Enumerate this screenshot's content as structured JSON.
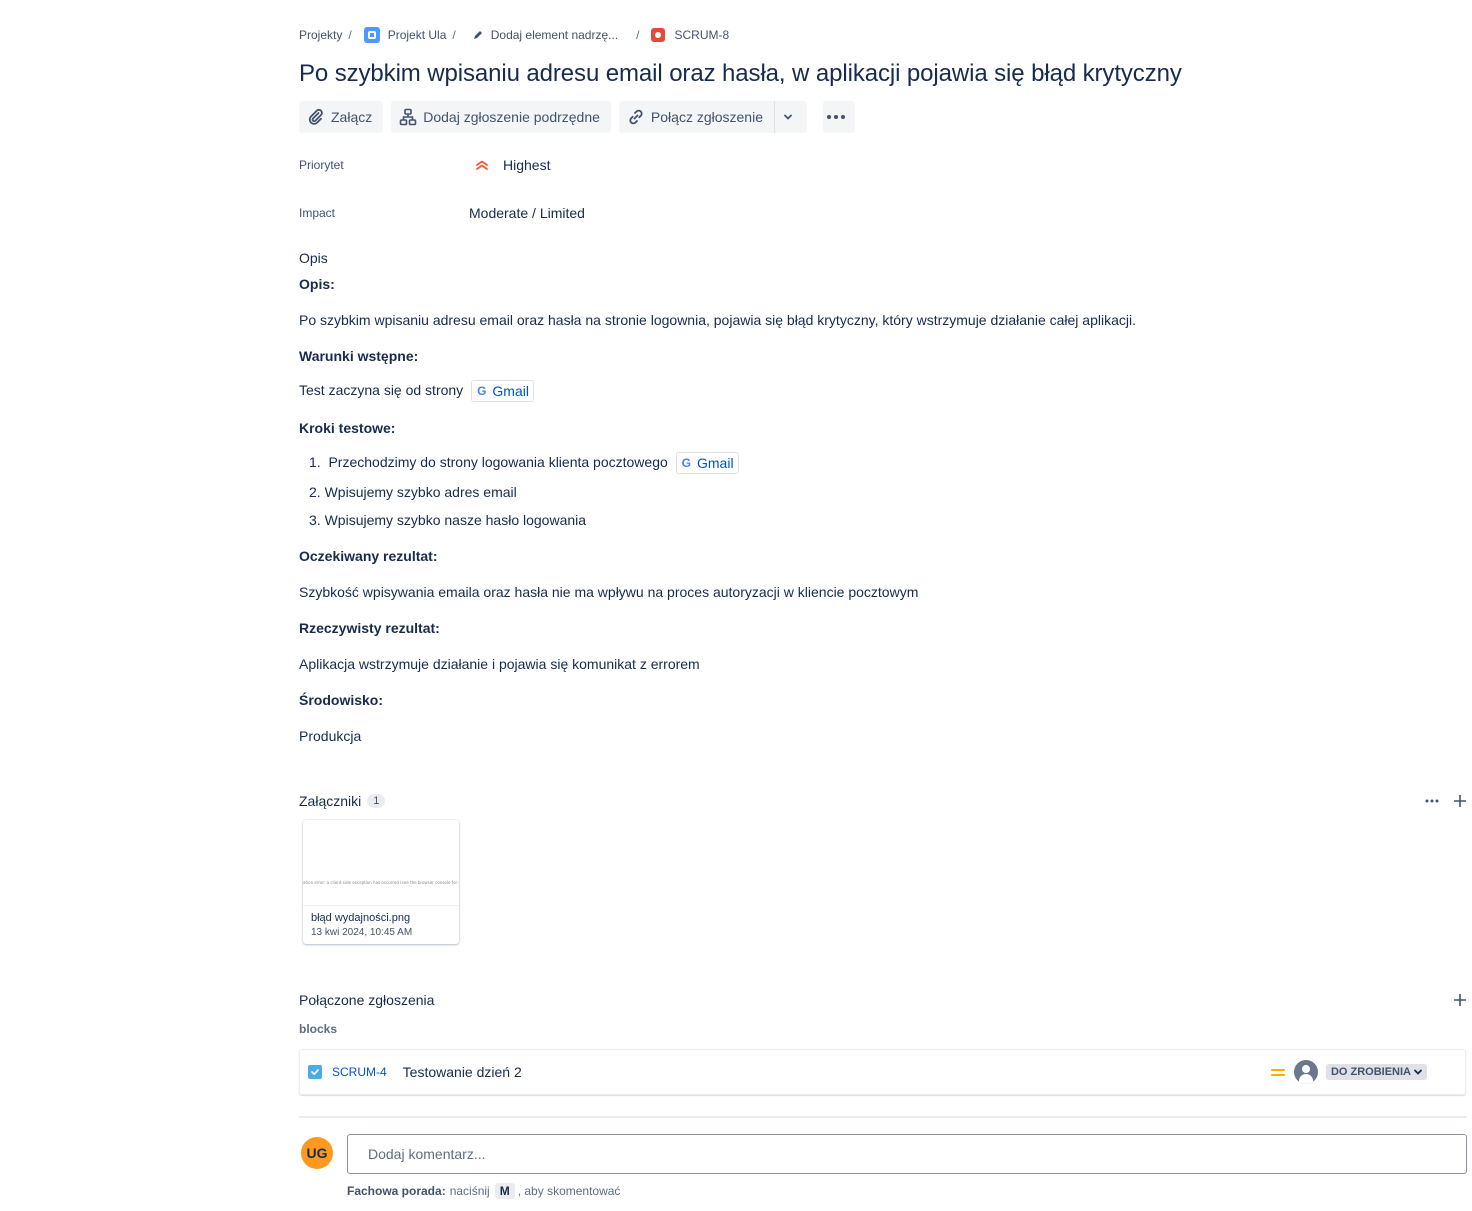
{
  "breadcrumb": {
    "projects": "Projekty",
    "project": "Projekt Ula",
    "parent": "Dodaj element nadrzę...",
    "issue_key": "SCRUM-8",
    "separator": "/"
  },
  "issue": {
    "title": "Po szybkim wpisaniu adresu email oraz hasła, w aplikacji pojawia się błąd krytyczny"
  },
  "toolbar": {
    "attach_label": "Załącz",
    "add_child_label": "Dodaj zgłoszenie podrzędne",
    "link_issue_label": "Połącz zgłoszenie"
  },
  "fields": {
    "priority_label": "Priorytet",
    "priority_value": "Highest",
    "impact_label": "Impact",
    "impact_value": "Moderate / Limited"
  },
  "description": {
    "section_label": "Opis",
    "heading_opis": "Opis:",
    "opis_text": "Po szybkim wpisaniu adresu email oraz hasła na stronie logownia, pojawia się błąd krytyczny, który wstrzymuje działanie całej aplikacji.",
    "heading_preconditions": "Warunki wstępne:",
    "preconditions_text": "Test zaczyna się od strony",
    "gmail_link": "Gmail",
    "heading_steps": "Kroki testowe:",
    "steps": [
      {
        "num": "1.",
        "text": "Przechodzimy do strony logowania klienta pocztowego"
      },
      {
        "num": "2.",
        "text": "Wpisujemy szybko adres email"
      },
      {
        "num": "3.",
        "text": "Wpisujemy szybko nasze hasło logowania"
      }
    ],
    "heading_expected": "Oczekiwany rezultat:",
    "expected_text": "Szybkość wpisywania emaila oraz hasła nie ma wpływu na proces autoryzacji w kliencie pocztowym",
    "heading_actual": "Rzeczywisty rezultat:",
    "actual_text": "Aplikacja wstrzymuje działanie i pojawia się komunikat z errorem",
    "heading_env": "Środowisko:",
    "env_text": "Produkcja"
  },
  "attachments": {
    "label": "Załączniki",
    "count": "1",
    "items": [
      {
        "name": "błąd wydajności.png",
        "date": "13 kwi 2024, 10:45 AM",
        "preview_text": "ation error: a client-side exception has occurred (see the browser console for more information)."
      }
    ]
  },
  "linked_issues": {
    "label": "Połączone zgłoszenia",
    "link_type": "blocks",
    "items": [
      {
        "key": "SCRUM-4",
        "summary": "Testowanie dzień 2",
        "status": "DO ZROBIENIA"
      }
    ]
  },
  "comment": {
    "avatar_initials": "UG",
    "placeholder": "Dodaj komentarz...",
    "tip_bold": "Fachowa porada:",
    "tip_pre": "naciśnij",
    "tip_key": "M",
    "tip_post": ", aby skomentować"
  },
  "colors": {
    "priority_highest": "#ff5630",
    "link_blue": "#0052cc",
    "medium_priority": "#ffab00",
    "bug_red": "#e5493a",
    "avatar_orange": "#ff991f"
  }
}
